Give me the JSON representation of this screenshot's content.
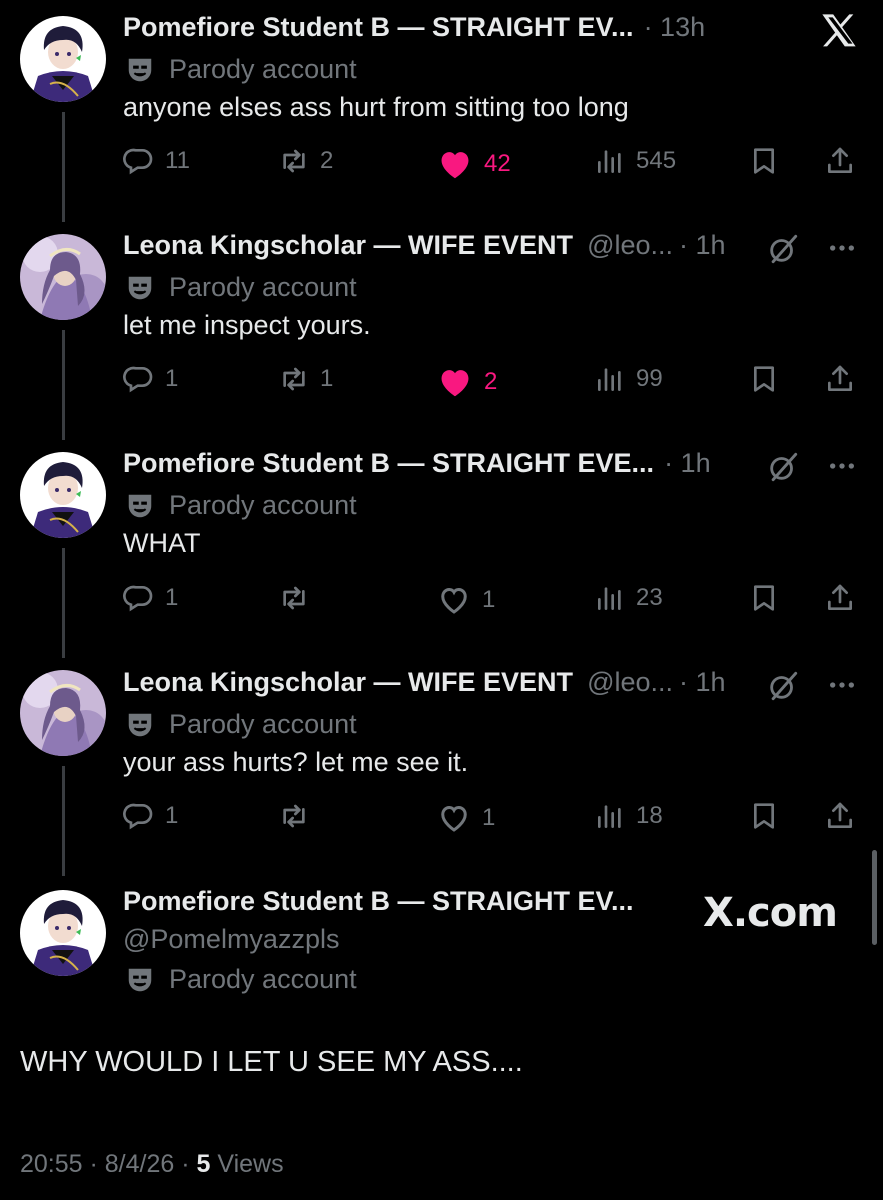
{
  "brand": {
    "x_logo": "X",
    "domain_watermark": "X.com"
  },
  "tweets": [
    {
      "name": "Pomefiore Student B — STRAIGHT EV...",
      "handle": "",
      "time": "· 13h",
      "parody": "Parody account",
      "text": "anyone elses ass hurt from sitting too long",
      "replies": "11",
      "reposts": "2",
      "likes": "42",
      "views": "545",
      "liked": true
    },
    {
      "name": "Leona Kingscholar — WIFE EVENT",
      "handle": "@leo...",
      "time": "· 1h",
      "parody": "Parody account",
      "text": "let me inspect yours.",
      "replies": "1",
      "reposts": "1",
      "likes": "2",
      "views": "99",
      "liked": true
    },
    {
      "name": "Pomefiore Student B — STRAIGHT EVE...",
      "handle": "",
      "time": "· 1h",
      "parody": "Parody account",
      "text": "WHAT",
      "replies": "1",
      "reposts": "",
      "likes": "1",
      "views": "23",
      "liked": false
    },
    {
      "name": "Leona Kingscholar — WIFE EVENT",
      "handle": "@leo...",
      "time": "· 1h",
      "parody": "Parody account",
      "text": "your ass hurts? let me see it.",
      "replies": "1",
      "reposts": "",
      "likes": "1",
      "views": "18",
      "liked": false
    }
  ],
  "main_tweet": {
    "name": "Pomefiore Student B — STRAIGHT EV...",
    "handle": "@Pomelmyazzpls",
    "parody": "Parody account",
    "text": "WHY WOULD I LET U SEE MY ASS....",
    "timestamp": "20:55 · 8/4/26 · ",
    "views_count": "5",
    "views_label": " Views"
  },
  "colors": {
    "like": "#f91880",
    "muted": "#71767b",
    "text": "#e7e9ea",
    "background": "#000000"
  },
  "icons": [
    "x-logo-icon",
    "grok-icon",
    "more-icon",
    "reply-icon",
    "repost-icon",
    "heart-icon",
    "views-icon",
    "bookmark-icon",
    "share-icon",
    "parody-mask-icon"
  ]
}
